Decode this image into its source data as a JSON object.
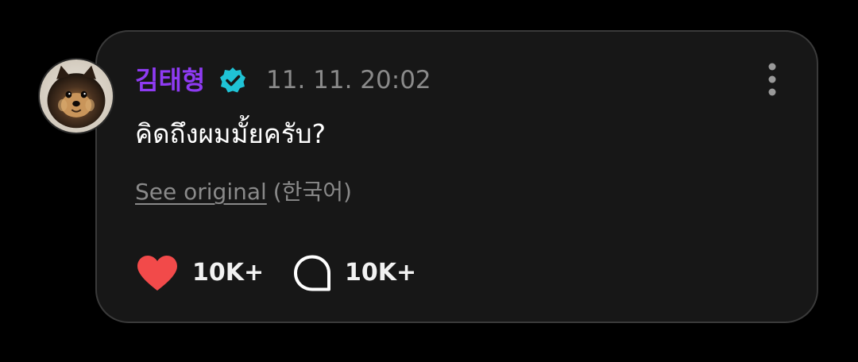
{
  "post": {
    "author": "김태형",
    "verified_icon": "verified-badge-icon",
    "timestamp": "11. 11. 20:02",
    "message": "คิดถึงผมมั้ยครับ?",
    "translation": {
      "link_label": "See original",
      "language": "(한국어)"
    },
    "reactions": {
      "likes": "10K+",
      "comments": "10K+"
    }
  },
  "icons": {
    "like": "heart-icon",
    "comment": "speech-bubble-icon",
    "more": "vertical-ellipsis-icon",
    "avatar": "pomeranian-dog-avatar"
  },
  "colors": {
    "background": "#000000",
    "card": "#171717",
    "author": "#8e3bf2",
    "verified": "#1fc3d6",
    "heart": "#f24a4a",
    "muted": "#8a8a8a",
    "text": "#ffffff"
  }
}
